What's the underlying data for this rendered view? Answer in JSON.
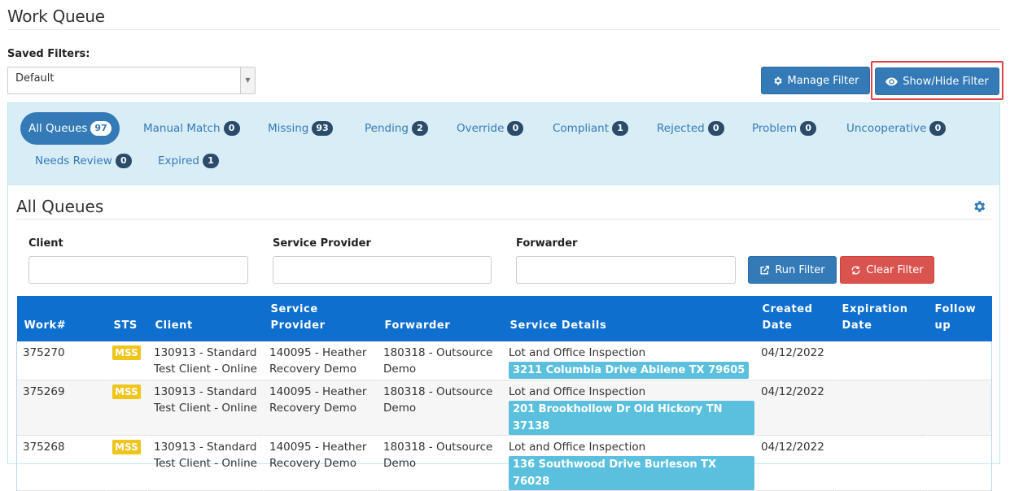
{
  "page": {
    "title": "Work Queue"
  },
  "saved_filters": {
    "label": "Saved Filters:",
    "selected": "Default"
  },
  "buttons": {
    "manage_filter": "Manage Filter",
    "show_hide_filter": "Show/Hide Filter",
    "run_filter": "Run Filter",
    "clear_filter": "Clear Filter"
  },
  "tabs": [
    {
      "label": "All Queues",
      "count": "97",
      "active": true
    },
    {
      "label": "Manual Match",
      "count": "0"
    },
    {
      "label": "Missing",
      "count": "93"
    },
    {
      "label": "Pending",
      "count": "2"
    },
    {
      "label": "Override",
      "count": "0"
    },
    {
      "label": "Compliant",
      "count": "1"
    },
    {
      "label": "Rejected",
      "count": "0"
    },
    {
      "label": "Problem",
      "count": "0"
    },
    {
      "label": "Uncooperative",
      "count": "0"
    },
    {
      "label": "Needs Review",
      "count": "0"
    },
    {
      "label": "Expired",
      "count": "1"
    }
  ],
  "section": {
    "title": "All Queues"
  },
  "filters": {
    "client_label": "Client",
    "service_provider_label": "Service Provider",
    "forwarder_label": "Forwarder",
    "client_value": "",
    "service_provider_value": "",
    "forwarder_value": ""
  },
  "table": {
    "headers": {
      "work": "Work#",
      "sts": "STS",
      "client": "Client",
      "service_provider_1": "Service",
      "service_provider_2": "Provider",
      "forwarder": "Forwarder",
      "service_details": "Service Details",
      "created_1": "Created",
      "created_2": "Date",
      "expiration_1": "Expiration",
      "expiration_2": "Date",
      "follow_1": "Follow",
      "follow_2": "up"
    },
    "rows": [
      {
        "work": "375270",
        "sts": "MSS",
        "client_1": "130913 - Standard",
        "client_2": "Test Client - Online",
        "provider_1": "140095 - Heather",
        "provider_2": "Recovery Demo",
        "forwarder_1": "180318 - Outsource",
        "forwarder_2": "Demo",
        "service": "Lot and Office Inspection",
        "address": "3211 Columbia Drive Abilene TX 79605",
        "created": "04/12/2022",
        "expiration": "",
        "followup": ""
      },
      {
        "work": "375269",
        "sts": "MSS",
        "client_1": "130913 - Standard",
        "client_2": "Test Client - Online",
        "provider_1": "140095 - Heather",
        "provider_2": "Recovery Demo",
        "forwarder_1": "180318 - Outsource",
        "forwarder_2": "Demo",
        "service": "Lot and Office Inspection",
        "address": "201 Brookhollow Dr Old Hickory TN 37138",
        "created": "04/12/2022",
        "expiration": "",
        "followup": ""
      },
      {
        "work": "375268",
        "sts": "MSS",
        "client_1": "130913 - Standard",
        "client_2": "Test Client - Online",
        "provider_1": "140095 - Heather",
        "provider_2": "Recovery Demo",
        "forwarder_1": "180318 - Outsource",
        "forwarder_2": "Demo",
        "service": "Lot and Office Inspection",
        "address": "136 Southwood Drive Burleson TX 76028",
        "created": "04/12/2022",
        "expiration": "",
        "followup": ""
      }
    ]
  },
  "colors": {
    "primary": "#337ab7",
    "header_blue": "#0f6fcf",
    "danger": "#d9534f",
    "info_panel": "#d9edf7",
    "address_badge": "#5bc0de",
    "sts_badge": "#f0c419",
    "highlight_border": "#e0454a"
  }
}
